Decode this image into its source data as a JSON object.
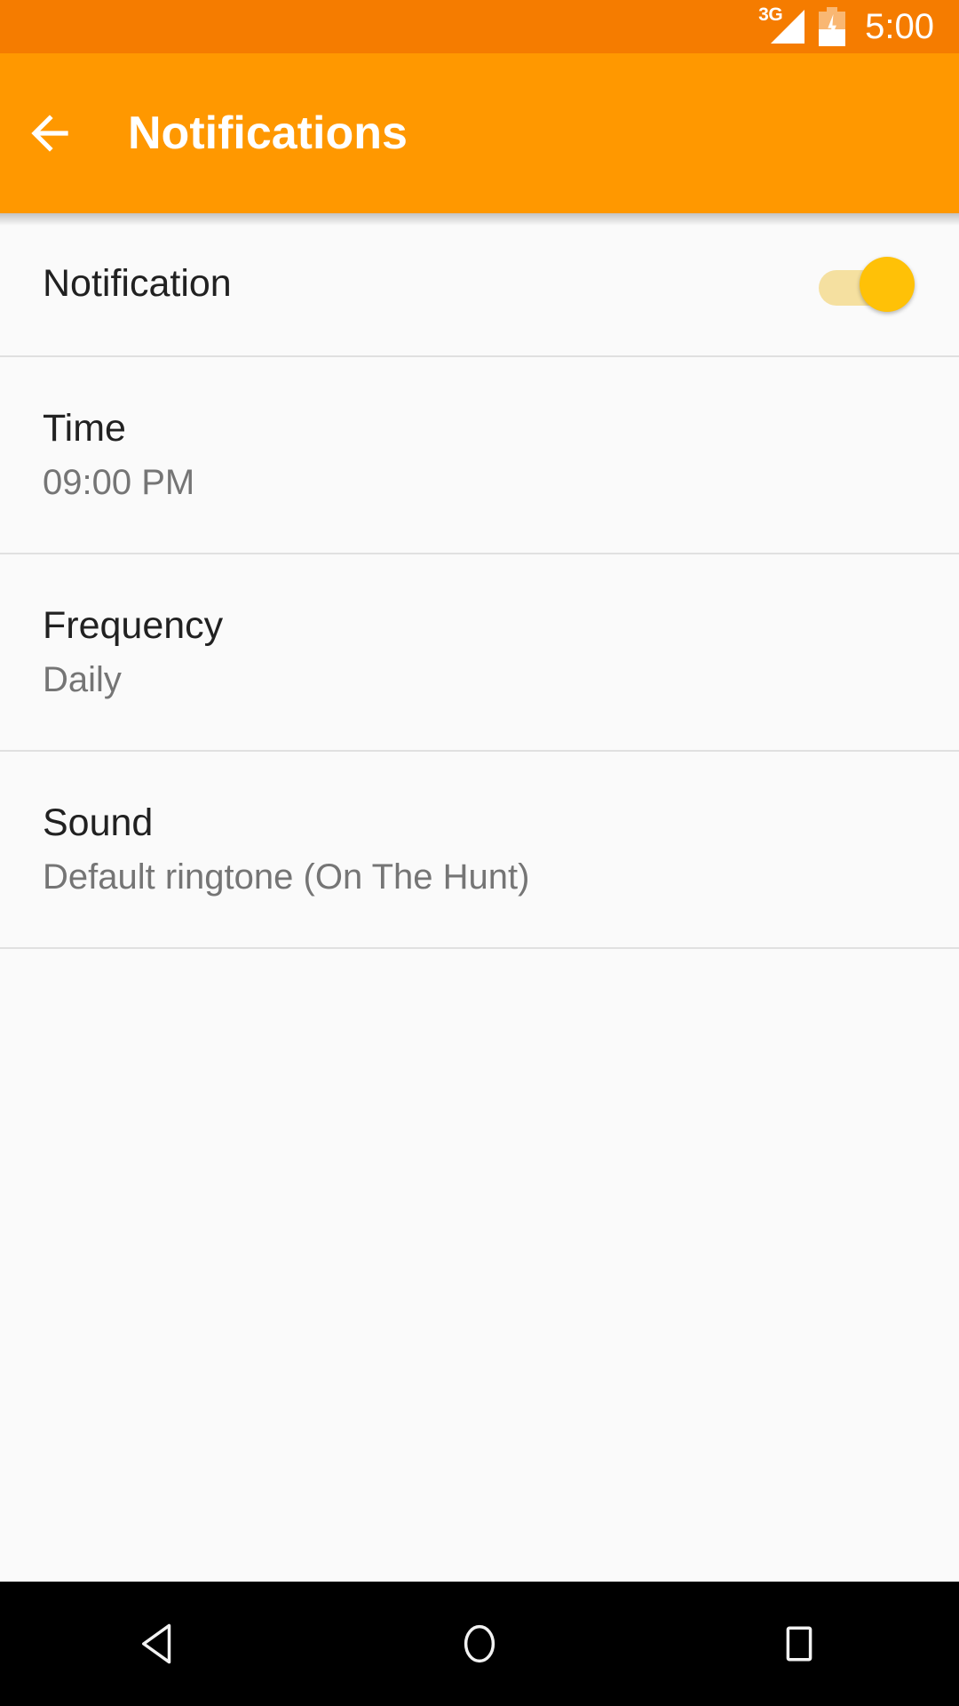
{
  "status_bar": {
    "network_label": "3G",
    "clock": "5:00",
    "signal_icon": "signal-bars-icon",
    "battery_icon": "battery-charging-icon",
    "background_color": "#F57C00"
  },
  "app_bar": {
    "back_icon": "arrow-back-icon",
    "title": "Notifications",
    "background_color": "#FF9800"
  },
  "settings": {
    "rows": [
      {
        "name": "notification",
        "title": "Notification",
        "subtitle": "",
        "type": "switch",
        "switch_on": true,
        "switch_thumb_color": "#FFC107",
        "switch_track_color": "#F5E0A0"
      },
      {
        "name": "time",
        "title": "Time",
        "subtitle": "09:00 PM",
        "type": "two-line"
      },
      {
        "name": "frequency",
        "title": "Frequency",
        "subtitle": "Daily",
        "type": "two-line"
      },
      {
        "name": "sound",
        "title": "Sound",
        "subtitle": "Default ringtone (On The Hunt)",
        "type": "two-line"
      }
    ]
  },
  "nav_bar": {
    "back_icon": "nav-back-triangle-icon",
    "home_icon": "nav-home-circle-icon",
    "recents_icon": "nav-recents-square-icon",
    "background_color": "#000000"
  }
}
